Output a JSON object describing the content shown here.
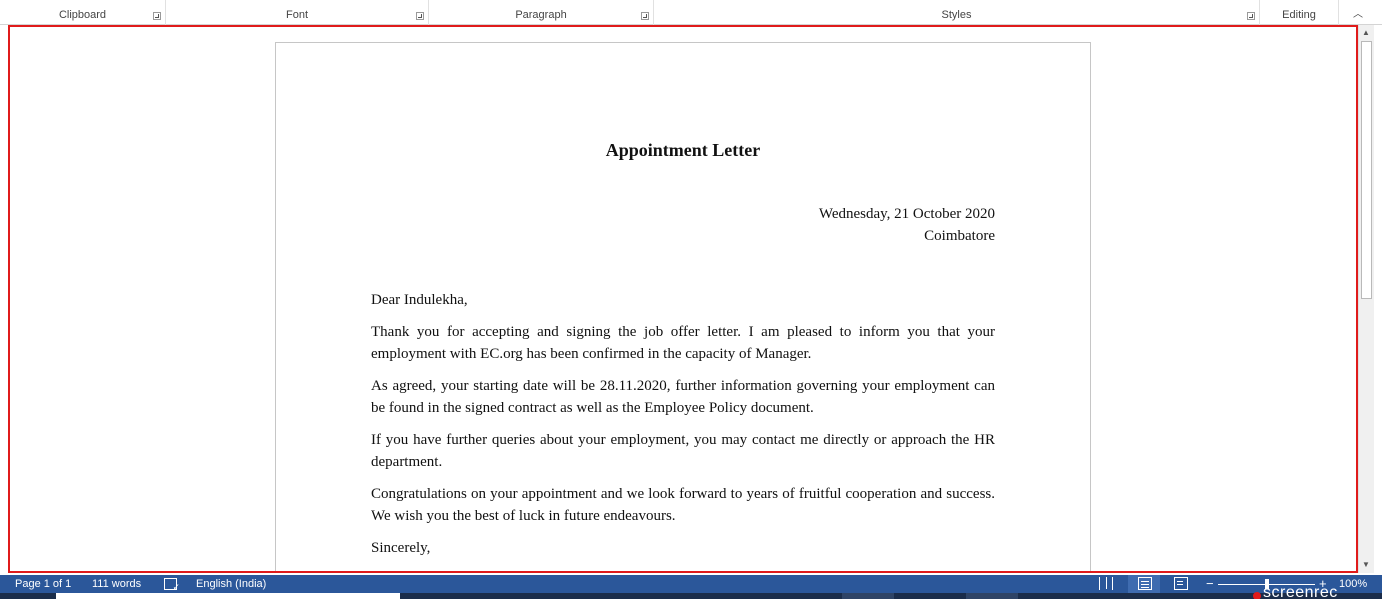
{
  "ribbon": {
    "groups": [
      {
        "label": "Clipboard"
      },
      {
        "label": "Font"
      },
      {
        "label": "Paragraph"
      },
      {
        "label": "Styles"
      },
      {
        "label": "Editing"
      }
    ],
    "collapse_icon": "chevron-up-icon"
  },
  "document": {
    "title": "Appointment Letter",
    "date": "Wednesday, 21 October 2020",
    "place": "Coimbatore",
    "salutation": "Dear Indulekha,",
    "paragraphs": [
      "Thank you for accepting and signing the job offer letter. I am pleased to inform you that your employment with EC.org has been confirmed in the capacity of Manager.",
      "As agreed, your starting date will be 28.11.2020, further information governing your employment can be found in the signed contract as well as the Employee Policy document.",
      "If you have further queries about your employment, you may contact me directly or approach the HR department.",
      "Congratulations on your appointment and we look forward to years of fruitful cooperation and success. We wish you the best of luck in future endeavours."
    ],
    "closing": "Sincerely,"
  },
  "status_bar": {
    "page": "Page 1 of 1",
    "words": "111 words",
    "language": "English (India)",
    "zoom": "100%",
    "zoom_minus": "−",
    "zoom_plus": "+",
    "zoom_fraction": 0.5
  },
  "overlay": {
    "watermark": "screenrec"
  },
  "colors": {
    "statusbar": "#2b579a",
    "selection_border": "#e01b1b"
  }
}
